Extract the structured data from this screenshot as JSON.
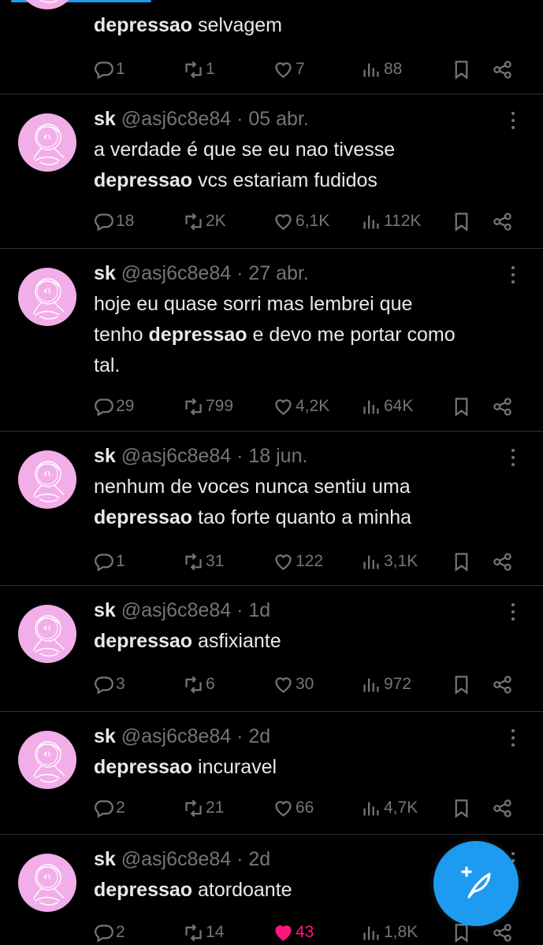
{
  "colors": {
    "accent": "#1d9bf0",
    "like": "#f91880",
    "avatar": "#f2aee8",
    "muted": "#71767b"
  },
  "tweets": [
    {
      "name": "",
      "handle": "",
      "dot": "",
      "date": "",
      "lines": [
        [
          {
            "b": true,
            "t": "depressao"
          },
          {
            "b": false,
            "t": " selvagem"
          }
        ]
      ],
      "reply": "1",
      "retweet": "1",
      "like": "7",
      "views": "88",
      "liked": false
    },
    {
      "name": "sk",
      "handle": "@asj6c8e84",
      "dot": "·",
      "date": "05 abr.",
      "lines": [
        [
          {
            "b": false,
            "t": "a verdade é que se eu nao tivesse"
          }
        ],
        [
          {
            "b": true,
            "t": "depressao"
          },
          {
            "b": false,
            "t": " vcs estariam fudidos"
          }
        ]
      ],
      "reply": "18",
      "retweet": "2K",
      "like": "6,1K",
      "views": "112K",
      "liked": false
    },
    {
      "name": "sk",
      "handle": "@asj6c8e84",
      "dot": "·",
      "date": "27 abr.",
      "lines": [
        [
          {
            "b": false,
            "t": "hoje eu quase sorri mas lembrei que"
          }
        ],
        [
          {
            "b": false,
            "t": "tenho "
          },
          {
            "b": true,
            "t": "depressao"
          },
          {
            "b": false,
            "t": " e devo me portar como"
          }
        ],
        [
          {
            "b": false,
            "t": "tal."
          }
        ]
      ],
      "reply": "29",
      "retweet": "799",
      "like": "4,2K",
      "views": "64K",
      "liked": false
    },
    {
      "name": "sk",
      "handle": "@asj6c8e84",
      "dot": "·",
      "date": "18 jun.",
      "lines": [
        [
          {
            "b": false,
            "t": "nenhum de voces nunca sentiu uma"
          }
        ],
        [
          {
            "b": true,
            "t": "depressao"
          },
          {
            "b": false,
            "t": " tao forte quanto a minha"
          }
        ]
      ],
      "reply": "1",
      "retweet": "31",
      "like": "122",
      "views": "3,1K",
      "liked": false
    },
    {
      "name": "sk",
      "handle": "@asj6c8e84",
      "dot": "·",
      "date": "1d",
      "lines": [
        [
          {
            "b": true,
            "t": "depressao"
          },
          {
            "b": false,
            "t": " asfixiante"
          }
        ]
      ],
      "reply": "3",
      "retweet": "6",
      "like": "30",
      "views": "972",
      "liked": false
    },
    {
      "name": "sk",
      "handle": "@asj6c8e84",
      "dot": "·",
      "date": "2d",
      "lines": [
        [
          {
            "b": true,
            "t": "depressao"
          },
          {
            "b": false,
            "t": " incuravel"
          }
        ]
      ],
      "reply": "2",
      "retweet": "21",
      "like": "66",
      "views": "4,7K",
      "liked": false
    },
    {
      "name": "sk",
      "handle": "@asj6c8e84",
      "dot": "·",
      "date": "2d",
      "lines": [
        [
          {
            "b": true,
            "t": "depressao"
          },
          {
            "b": false,
            "t": " atordoante"
          }
        ]
      ],
      "reply": "2",
      "retweet": "14",
      "like": "43",
      "views": "1,8K",
      "liked": true
    }
  ],
  "icons": {
    "reply": "reply-icon",
    "retweet": "retweet-icon",
    "like": "heart-icon",
    "views": "views-icon",
    "bookmark": "bookmark-icon",
    "share": "share-icon",
    "more": "more-icon",
    "compose": "compose-icon"
  }
}
